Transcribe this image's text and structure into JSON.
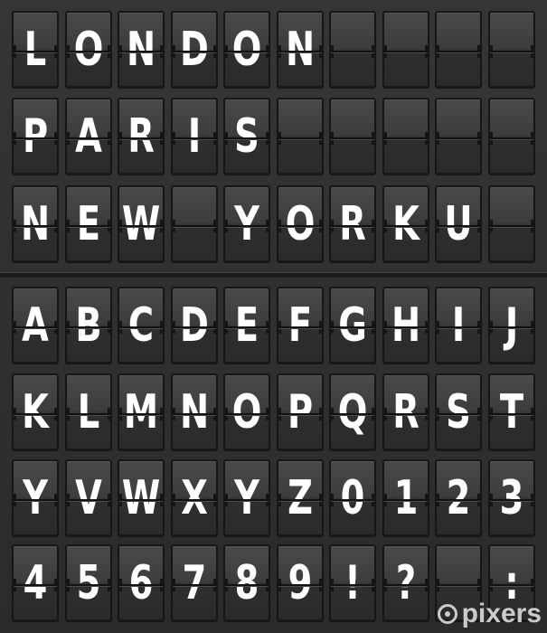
{
  "board": {
    "rows": [
      [
        "L",
        "O",
        "N",
        "D",
        "O",
        "N",
        "",
        "",
        "",
        ""
      ],
      [
        "P",
        "A",
        "R",
        "I",
        "S",
        "",
        "",
        "",
        "",
        ""
      ],
      [
        "N",
        "E",
        "W",
        "",
        "Y",
        "O",
        "R",
        "K",
        "U",
        ""
      ],
      [
        "A",
        "B",
        "C",
        "D",
        "E",
        "F",
        "G",
        "H",
        "I",
        "J"
      ],
      [
        "K",
        "L",
        "M",
        "N",
        "O",
        "P",
        "Q",
        "R",
        "S",
        "T"
      ],
      [
        "Y",
        "V",
        "W",
        "X",
        "Y",
        "Z",
        "0",
        "1",
        "2",
        "3"
      ],
      [
        "4",
        "5",
        "6",
        "7",
        "8",
        "9",
        "!",
        "?",
        "",
        ":"
      ]
    ]
  },
  "watermark": {
    "text": "pixers"
  }
}
